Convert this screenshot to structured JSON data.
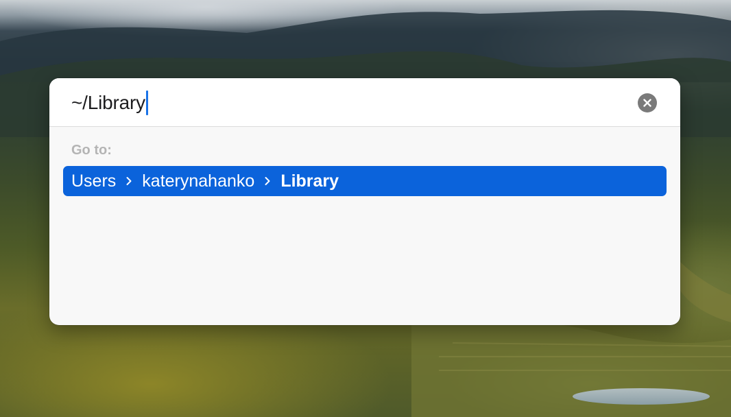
{
  "go_to_dialog": {
    "path_value": "~/Library",
    "section_label": "Go to:",
    "result": {
      "crumbs": [
        "Users",
        "katerynahanko",
        "Library"
      ]
    }
  },
  "icons": {
    "clear": "clear-x-circle-icon",
    "separator": "chevron-right-icon"
  },
  "colors": {
    "selection": "#0b63db",
    "caret": "#1a73e8"
  }
}
